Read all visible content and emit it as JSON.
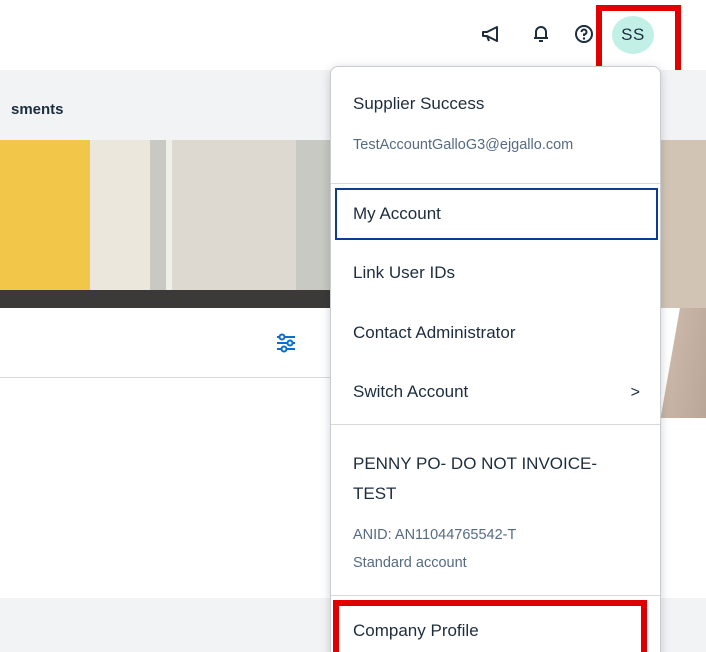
{
  "header": {
    "icons": [
      "megaphone-icon",
      "bell-icon",
      "help-icon"
    ],
    "avatar_initials": "SS",
    "avatar_color": "#c2f0e6"
  },
  "page": {
    "breadcrumb": "sments"
  },
  "menu": {
    "user_name": "Supplier Success",
    "user_email": "TestAccountGalloG3@ejgallo.com",
    "items": [
      {
        "label": "My Account"
      },
      {
        "label": "Link User IDs"
      },
      {
        "label": "Contact Administrator"
      },
      {
        "label": "Switch Account"
      }
    ],
    "switch_chevron": ">",
    "company": {
      "name": "PENNY PO- DO NOT INVOICE-TEST",
      "anid": "ANID: AN11044765542-T",
      "account_type": "Standard account"
    },
    "company_profile": "Company Profile"
  },
  "colors": {
    "highlight": "#e00000",
    "focus_border": "#0b3d91"
  }
}
